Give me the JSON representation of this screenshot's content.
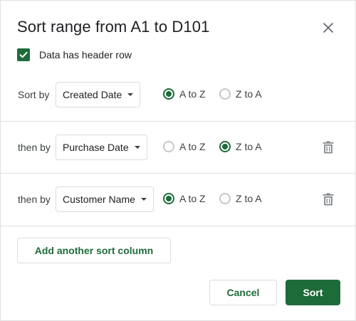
{
  "dialog": {
    "title": "Sort range from A1 to D101",
    "close_icon": "close-icon"
  },
  "header_row": {
    "checked": true,
    "label": "Data has header row"
  },
  "rows": [
    {
      "label": "Sort by",
      "column": "Created Date",
      "options": [
        "A to Z",
        "Z to A"
      ],
      "selected": "A to Z",
      "deletable": false
    },
    {
      "label": "then by",
      "column": "Purchase Date",
      "options": [
        "A to Z",
        "Z to A"
      ],
      "selected": "Z to A",
      "deletable": true
    },
    {
      "label": "then by",
      "column": "Customer Name",
      "options": [
        "A to Z",
        "Z to A"
      ],
      "selected": "A to Z",
      "deletable": true
    }
  ],
  "actions": {
    "add_label": "Add another sort column",
    "cancel_label": "Cancel",
    "sort_label": "Sort"
  },
  "colors": {
    "accent": "#1e6b3a",
    "border": "#dadce0",
    "divider": "#e0e0e0"
  }
}
